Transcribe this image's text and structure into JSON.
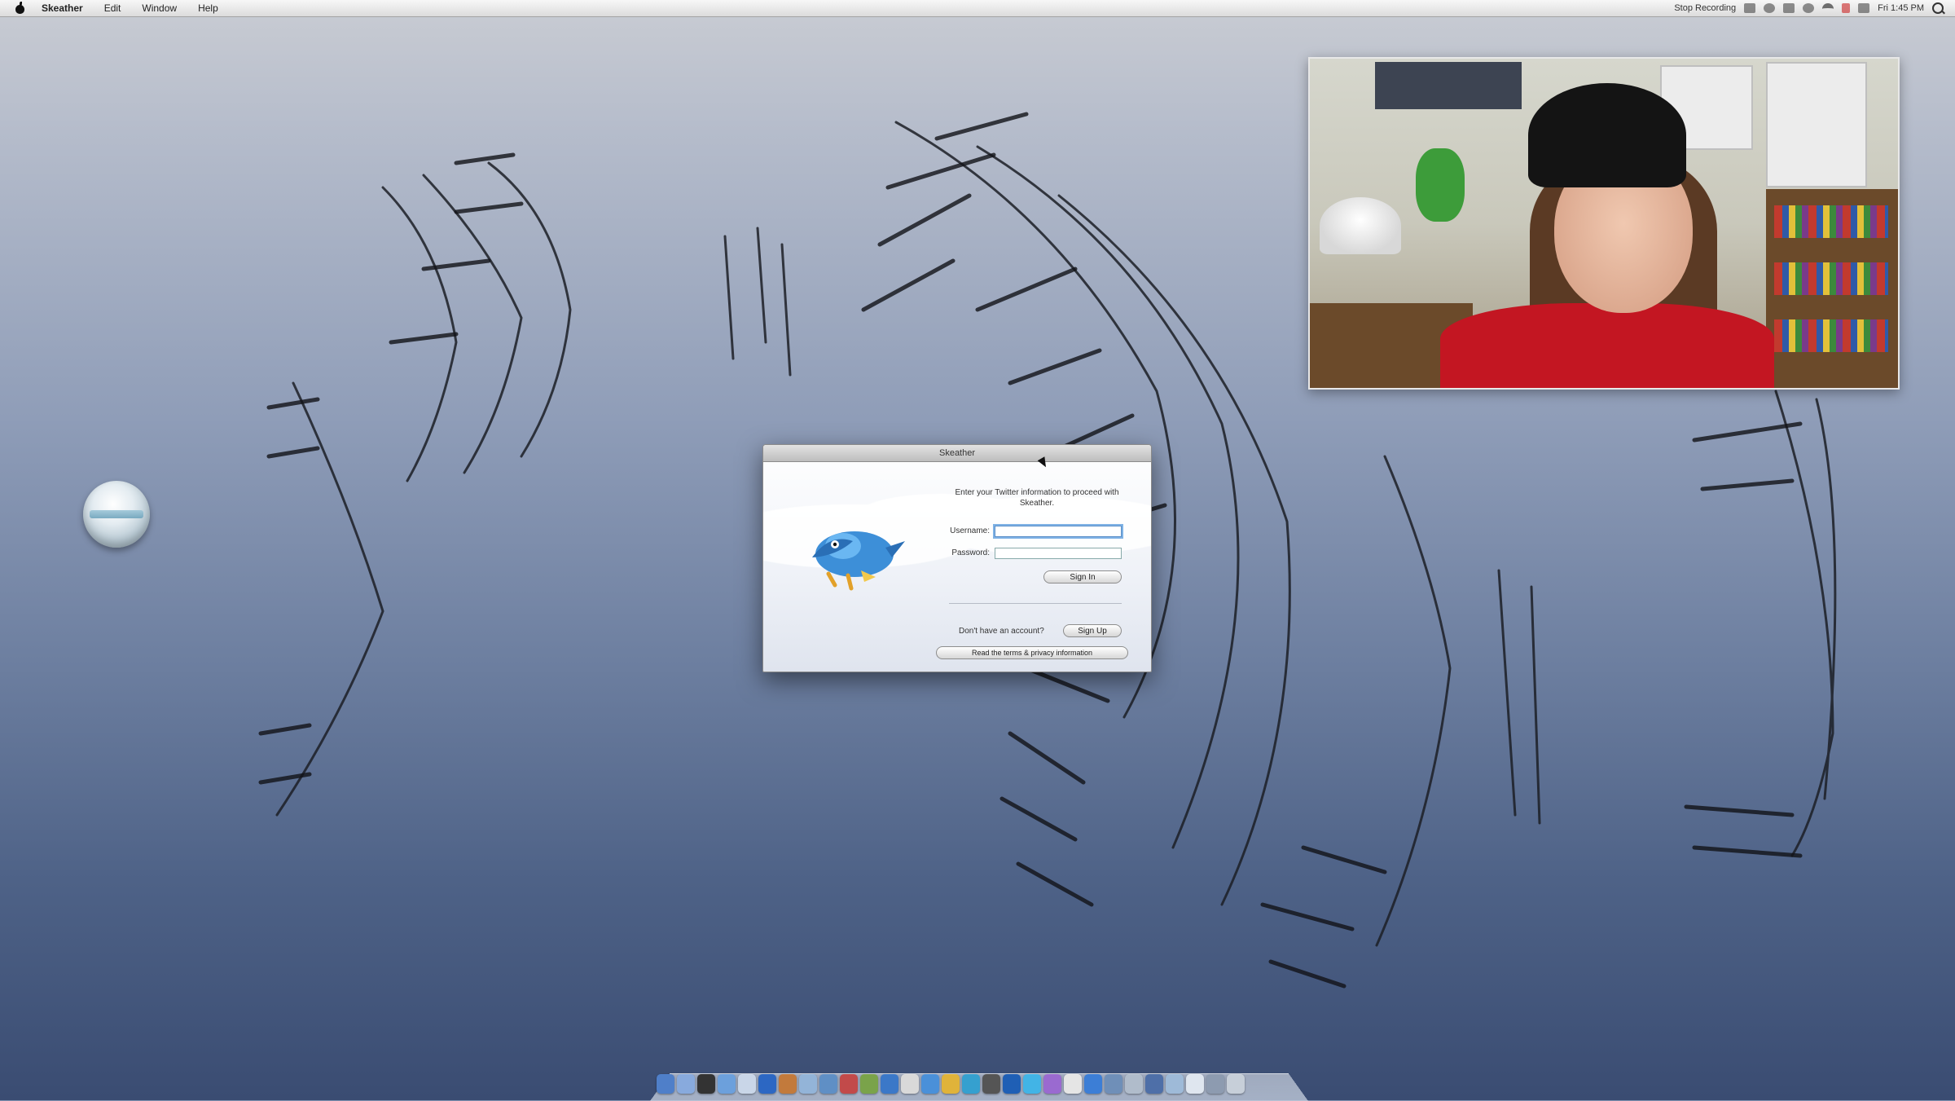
{
  "menubar": {
    "app_name": "Skeather",
    "items": [
      "Edit",
      "Window",
      "Help"
    ],
    "status_text": "Stop Recording",
    "clock": "Fri 1:45 PM"
  },
  "dialog": {
    "title": "Skeather",
    "message": "Enter your Twitter information to proceed with Skeather.",
    "username_label": "Username:",
    "username_value": "",
    "password_label": "Password:",
    "password_value": "",
    "sign_in_label": "Sign In",
    "no_account_text": "Don't have an account?",
    "sign_up_label": "Sign Up",
    "privacy_label": "Read the terms & privacy information"
  },
  "colors": {
    "dialog_focus": "#7fb2e5",
    "sweater": "#c31622",
    "bird": "#3d8fd8"
  },
  "icons": [
    "apple-icon",
    "search-icon",
    "wifi-icon",
    "volume-icon",
    "bird-icon",
    "disk-icon"
  ]
}
